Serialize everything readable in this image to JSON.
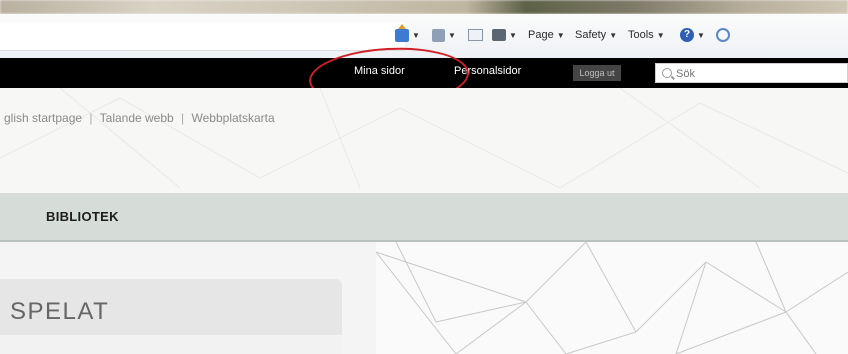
{
  "browser": {
    "commands": [
      {
        "key": "home",
        "icon": "home-icon"
      },
      {
        "key": "feeds",
        "icon": "feed-icon"
      },
      {
        "key": "mail",
        "icon": "mail-icon"
      },
      {
        "key": "print",
        "icon": "print-icon"
      },
      {
        "key": "page",
        "label": "Page"
      },
      {
        "key": "safety",
        "label": "Safety"
      },
      {
        "key": "tools",
        "label": "Tools"
      },
      {
        "key": "help",
        "icon": "help-icon"
      }
    ]
  },
  "topnav": {
    "mina_sidor": "Mina sidor",
    "personalsidor": "Personalsidor",
    "logout": "Logga ut",
    "search_placeholder": "Sök"
  },
  "breadcrumb": {
    "items": [
      "glish startpage",
      "Talande webb",
      "Webbplatskarta"
    ]
  },
  "section": {
    "title": "BIBLIOTEK"
  },
  "card": {
    "title": "SPELAT"
  },
  "colors": {
    "header_bg": "#000000",
    "band_bg": "#d6ddd9",
    "annotation": "#d11f26"
  }
}
